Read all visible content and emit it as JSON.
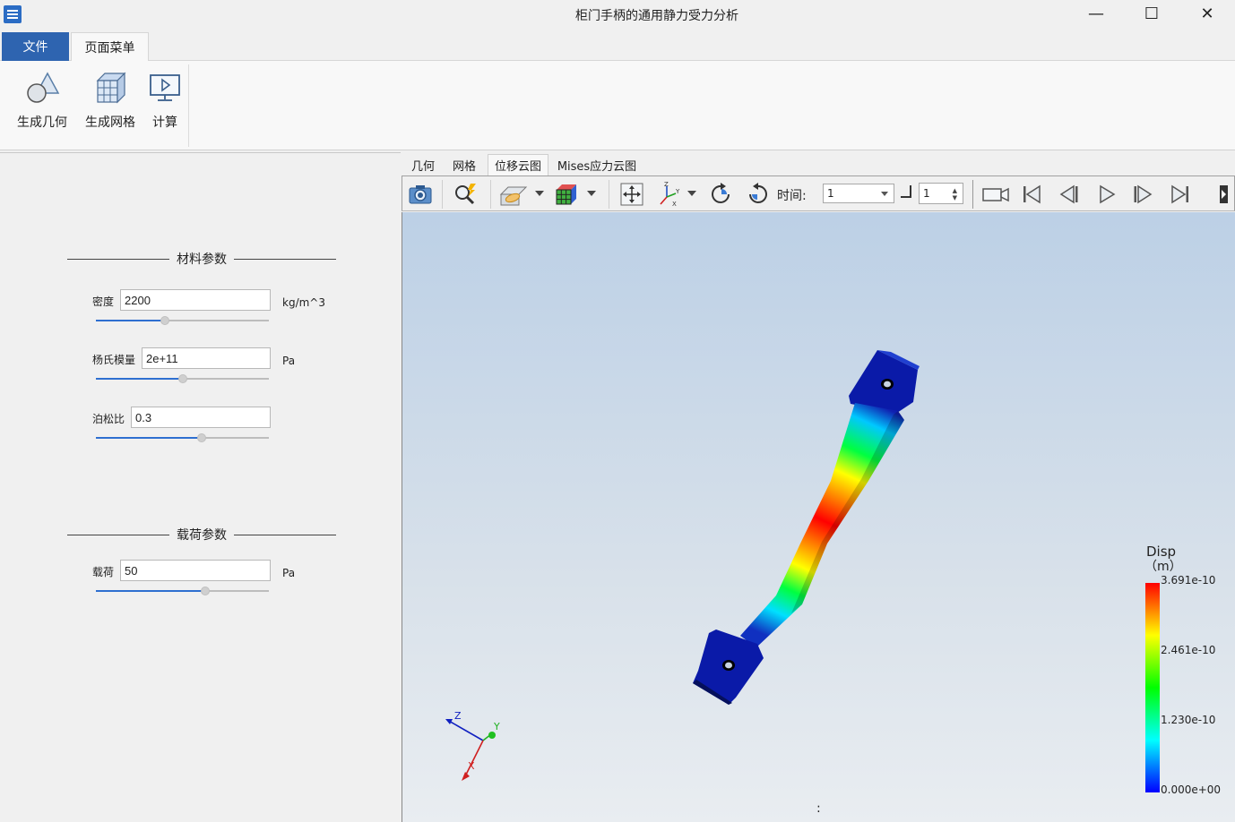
{
  "window": {
    "title": "柜门手柄的通用静力受力分析",
    "minimize_glyph": "—",
    "maximize_glyph": "☐",
    "close_glyph": "✕"
  },
  "ribbon": {
    "tabs": [
      "文件",
      "页面菜单"
    ],
    "active_tab": "页面菜单",
    "buttons": [
      {
        "label": "生成几何",
        "icon": "geometry-icon"
      },
      {
        "label": "生成网格",
        "icon": "mesh-icon"
      },
      {
        "label": "计算",
        "icon": "compute-icon"
      }
    ]
  },
  "material": {
    "section_title": "材料参数",
    "density": {
      "label": "密度",
      "value": "2200",
      "unit": "kg/m^3",
      "slider_fraction": 0.4
    },
    "youngs": {
      "label": "杨氏模量",
      "value": "2e+11",
      "unit": "Pa",
      "slider_fraction": 0.5
    },
    "poisson": {
      "label": "泊松比",
      "value": "0.3",
      "slider_fraction": 0.61
    }
  },
  "load": {
    "section_title": "载荷参数",
    "load": {
      "label": "载荷",
      "value": "50",
      "unit": "Pa",
      "slider_fraction": 0.63
    }
  },
  "view_tabs": [
    "几何",
    "网格",
    "位移云图",
    "Mises应力云图"
  ],
  "active_view_tab": "位移云图",
  "toolbar": {
    "time_label": "时间:",
    "time_value": "1",
    "step_value": "1"
  },
  "colorbar": {
    "title": "Disp",
    "unit": "（m）",
    "labels": [
      "3.691e-10",
      "2.461e-10",
      "1.230e-10",
      "0.000e+00"
    ],
    "colors": [
      "#ff0000",
      "#ffff00",
      "#00ff00",
      "#00ffff",
      "#0000ff"
    ]
  },
  "axes": {
    "x": "X",
    "y": "Y",
    "z": "Z"
  },
  "status_text": ":"
}
